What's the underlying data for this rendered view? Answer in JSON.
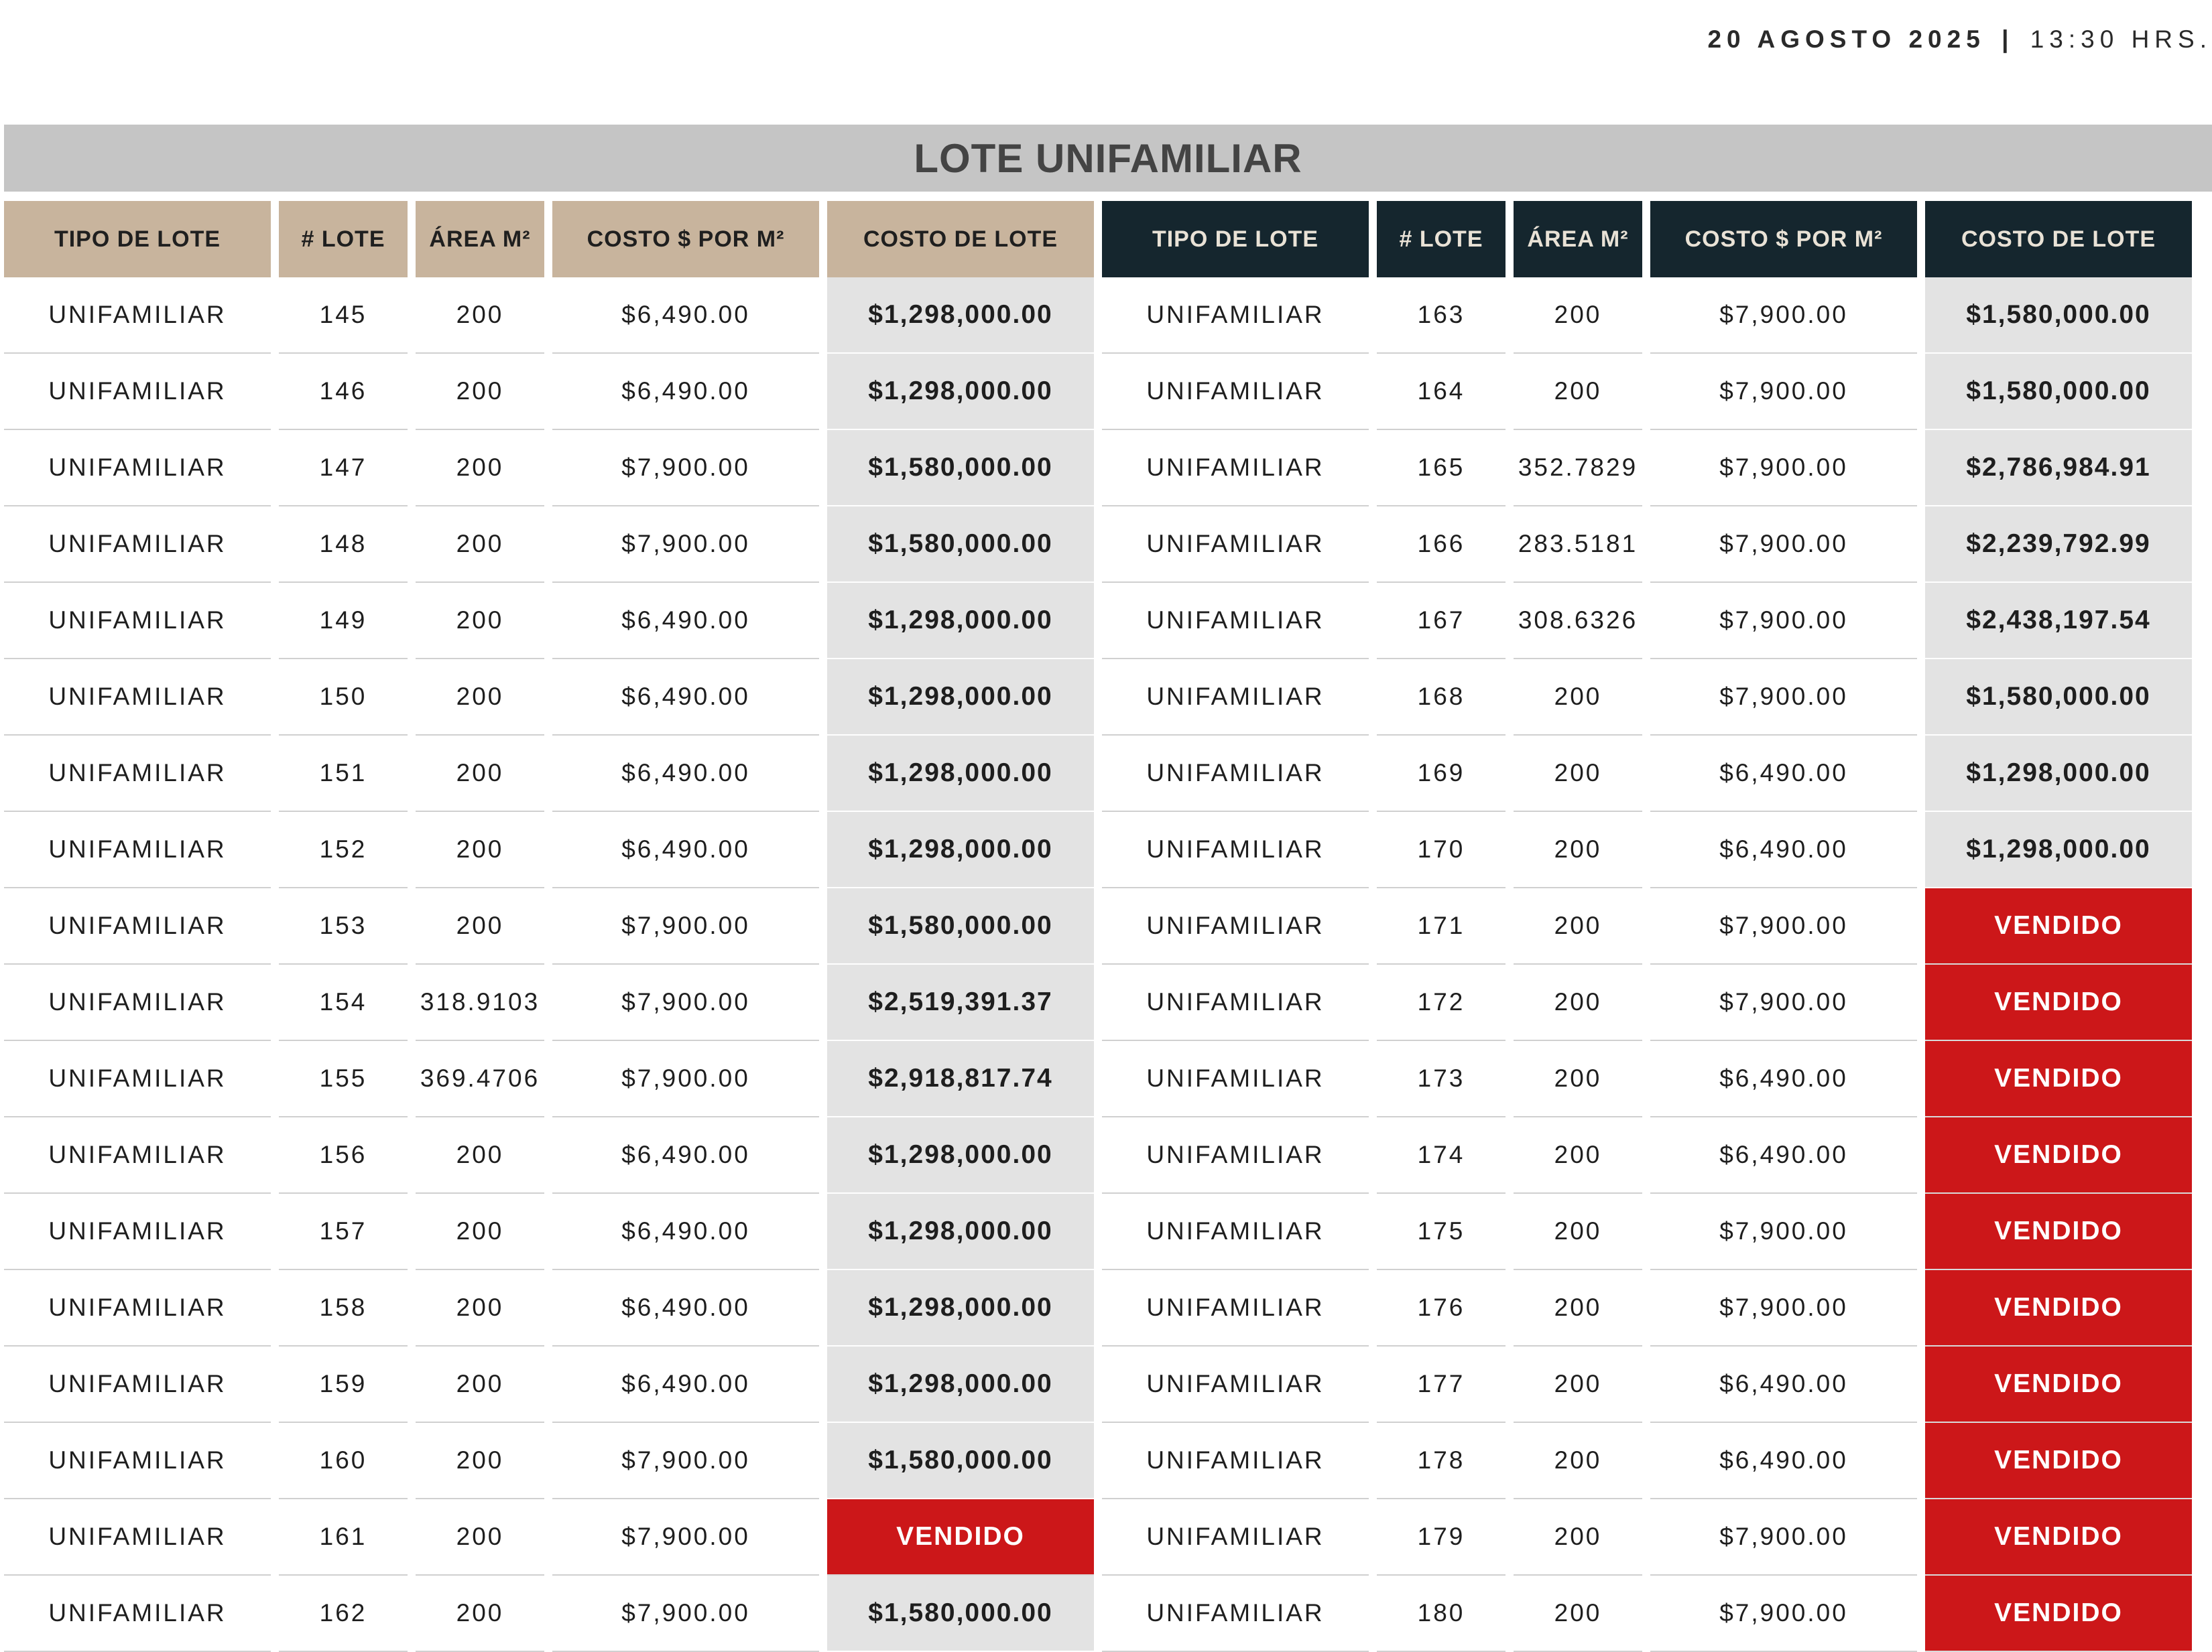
{
  "header": {
    "date": "20 AGOSTO 2025",
    "separator": "|",
    "time": "13:30 HRS."
  },
  "title": "LOTE UNIFAMILIAR",
  "columns": [
    "TIPO DE LOTE",
    "# LOTE",
    "ÁREA M²",
    "COSTO $ POR M²",
    "COSTO DE LOTE"
  ],
  "colors": {
    "left_header": "#c8b49d",
    "right_header": "#15262e",
    "cost_cell": "#e3e3e3",
    "sold": "#cc1719",
    "title_bar": "#c5c5c5"
  },
  "rows": [
    {
      "left": {
        "tipo": "UNIFAMILIAR",
        "lote": "145",
        "area": "200",
        "precio_m2": "$6,490.00",
        "costo": "$1,298,000.00",
        "sold": false
      },
      "right": {
        "tipo": "UNIFAMILIAR",
        "lote": "163",
        "area": "200",
        "precio_m2": "$7,900.00",
        "costo": "$1,580,000.00",
        "sold": false
      }
    },
    {
      "left": {
        "tipo": "UNIFAMILIAR",
        "lote": "146",
        "area": "200",
        "precio_m2": "$6,490.00",
        "costo": "$1,298,000.00",
        "sold": false
      },
      "right": {
        "tipo": "UNIFAMILIAR",
        "lote": "164",
        "area": "200",
        "precio_m2": "$7,900.00",
        "costo": "$1,580,000.00",
        "sold": false
      }
    },
    {
      "left": {
        "tipo": "UNIFAMILIAR",
        "lote": "147",
        "area": "200",
        "precio_m2": "$7,900.00",
        "costo": "$1,580,000.00",
        "sold": false
      },
      "right": {
        "tipo": "UNIFAMILIAR",
        "lote": "165",
        "area": "352.7829",
        "precio_m2": "$7,900.00",
        "costo": "$2,786,984.91",
        "sold": false
      }
    },
    {
      "left": {
        "tipo": "UNIFAMILIAR",
        "lote": "148",
        "area": "200",
        "precio_m2": "$7,900.00",
        "costo": "$1,580,000.00",
        "sold": false
      },
      "right": {
        "tipo": "UNIFAMILIAR",
        "lote": "166",
        "area": "283.5181",
        "precio_m2": "$7,900.00",
        "costo": "$2,239,792.99",
        "sold": false
      }
    },
    {
      "left": {
        "tipo": "UNIFAMILIAR",
        "lote": "149",
        "area": "200",
        "precio_m2": "$6,490.00",
        "costo": "$1,298,000.00",
        "sold": false
      },
      "right": {
        "tipo": "UNIFAMILIAR",
        "lote": "167",
        "area": "308.6326",
        "precio_m2": "$7,900.00",
        "costo": "$2,438,197.54",
        "sold": false
      }
    },
    {
      "left": {
        "tipo": "UNIFAMILIAR",
        "lote": "150",
        "area": "200",
        "precio_m2": "$6,490.00",
        "costo": "$1,298,000.00",
        "sold": false
      },
      "right": {
        "tipo": "UNIFAMILIAR",
        "lote": "168",
        "area": "200",
        "precio_m2": "$7,900.00",
        "costo": "$1,580,000.00",
        "sold": false
      }
    },
    {
      "left": {
        "tipo": "UNIFAMILIAR",
        "lote": "151",
        "area": "200",
        "precio_m2": "$6,490.00",
        "costo": "$1,298,000.00",
        "sold": false
      },
      "right": {
        "tipo": "UNIFAMILIAR",
        "lote": "169",
        "area": "200",
        "precio_m2": "$6,490.00",
        "costo": "$1,298,000.00",
        "sold": false
      }
    },
    {
      "left": {
        "tipo": "UNIFAMILIAR",
        "lote": "152",
        "area": "200",
        "precio_m2": "$6,490.00",
        "costo": "$1,298,000.00",
        "sold": false
      },
      "right": {
        "tipo": "UNIFAMILIAR",
        "lote": "170",
        "area": "200",
        "precio_m2": "$6,490.00",
        "costo": "$1,298,000.00",
        "sold": false
      }
    },
    {
      "left": {
        "tipo": "UNIFAMILIAR",
        "lote": "153",
        "area": "200",
        "precio_m2": "$7,900.00",
        "costo": "$1,580,000.00",
        "sold": false
      },
      "right": {
        "tipo": "UNIFAMILIAR",
        "lote": "171",
        "area": "200",
        "precio_m2": "$7,900.00",
        "costo": "VENDIDO",
        "sold": true
      }
    },
    {
      "left": {
        "tipo": "UNIFAMILIAR",
        "lote": "154",
        "area": "318.9103",
        "precio_m2": "$7,900.00",
        "costo": "$2,519,391.37",
        "sold": false
      },
      "right": {
        "tipo": "UNIFAMILIAR",
        "lote": "172",
        "area": "200",
        "precio_m2": "$7,900.00",
        "costo": "VENDIDO",
        "sold": true
      }
    },
    {
      "left": {
        "tipo": "UNIFAMILIAR",
        "lote": "155",
        "area": "369.4706",
        "precio_m2": "$7,900.00",
        "costo": "$2,918,817.74",
        "sold": false
      },
      "right": {
        "tipo": "UNIFAMILIAR",
        "lote": "173",
        "area": "200",
        "precio_m2": "$6,490.00",
        "costo": "VENDIDO",
        "sold": true
      }
    },
    {
      "left": {
        "tipo": "UNIFAMILIAR",
        "lote": "156",
        "area": "200",
        "precio_m2": "$6,490.00",
        "costo": "$1,298,000.00",
        "sold": false
      },
      "right": {
        "tipo": "UNIFAMILIAR",
        "lote": "174",
        "area": "200",
        "precio_m2": "$6,490.00",
        "costo": "VENDIDO",
        "sold": true
      }
    },
    {
      "left": {
        "tipo": "UNIFAMILIAR",
        "lote": "157",
        "area": "200",
        "precio_m2": "$6,490.00",
        "costo": "$1,298,000.00",
        "sold": false
      },
      "right": {
        "tipo": "UNIFAMILIAR",
        "lote": "175",
        "area": "200",
        "precio_m2": "$7,900.00",
        "costo": "VENDIDO",
        "sold": true
      }
    },
    {
      "left": {
        "tipo": "UNIFAMILIAR",
        "lote": "158",
        "area": "200",
        "precio_m2": "$6,490.00",
        "costo": "$1,298,000.00",
        "sold": false
      },
      "right": {
        "tipo": "UNIFAMILIAR",
        "lote": "176",
        "area": "200",
        "precio_m2": "$7,900.00",
        "costo": "VENDIDO",
        "sold": true
      }
    },
    {
      "left": {
        "tipo": "UNIFAMILIAR",
        "lote": "159",
        "area": "200",
        "precio_m2": "$6,490.00",
        "costo": "$1,298,000.00",
        "sold": false
      },
      "right": {
        "tipo": "UNIFAMILIAR",
        "lote": "177",
        "area": "200",
        "precio_m2": "$6,490.00",
        "costo": "VENDIDO",
        "sold": true
      }
    },
    {
      "left": {
        "tipo": "UNIFAMILIAR",
        "lote": "160",
        "area": "200",
        "precio_m2": "$7,900.00",
        "costo": "$1,580,000.00",
        "sold": false
      },
      "right": {
        "tipo": "UNIFAMILIAR",
        "lote": "178",
        "area": "200",
        "precio_m2": "$6,490.00",
        "costo": "VENDIDO",
        "sold": true
      }
    },
    {
      "left": {
        "tipo": "UNIFAMILIAR",
        "lote": "161",
        "area": "200",
        "precio_m2": "$7,900.00",
        "costo": "VENDIDO",
        "sold": true
      },
      "right": {
        "tipo": "UNIFAMILIAR",
        "lote": "179",
        "area": "200",
        "precio_m2": "$7,900.00",
        "costo": "VENDIDO",
        "sold": true
      }
    },
    {
      "left": {
        "tipo": "UNIFAMILIAR",
        "lote": "162",
        "area": "200",
        "precio_m2": "$7,900.00",
        "costo": "$1,580,000.00",
        "sold": false
      },
      "right": {
        "tipo": "UNIFAMILIAR",
        "lote": "180",
        "area": "200",
        "precio_m2": "$7,900.00",
        "costo": "VENDIDO",
        "sold": true
      }
    }
  ]
}
